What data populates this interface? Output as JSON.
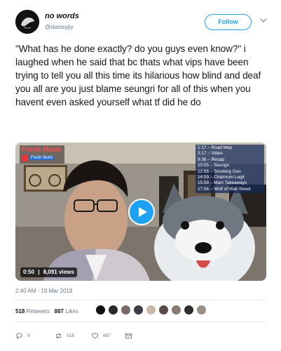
{
  "user": {
    "display_name": "no words",
    "handle": "@daissyjiy",
    "follow_label": "Follow"
  },
  "tweet": {
    "text": "\"What has he done exactly? do you guys even know?\" i laughed when he said that bc thats what vips have been trying to tell you all this time its hilarious how blind and deaf you all are you just blame seungri for all of this when you havent even asked yourself what tf did he do"
  },
  "video": {
    "brand_title": "Fresh Illumi",
    "brand_sub": "Fresh Illumi",
    "duration": "0:50",
    "views": "8,091 views",
    "chapters": [
      "1:17 – Road Map",
      "3:17 – Video",
      "9:36 – Recap",
      "10:55 – Seungri",
      "12:56 – Smoking Gun",
      "14:09 – Chatroom Legit",
      "15:58 – Main Takeaways",
      "17:56 – Wolf of Wall Street"
    ]
  },
  "meta": {
    "timestamp": "2:40 AM - 19 Mar 2019"
  },
  "stats": {
    "retweets_count": "518",
    "retweets_label": "Retweets",
    "likes_count": "887",
    "likes_label": "Likes"
  },
  "actions": {
    "reply_count": "9",
    "retweet_count": "518",
    "like_count": "887"
  },
  "colors": {
    "accent": "#1da1f2",
    "text": "#14171a",
    "muted": "#657786"
  },
  "icons": [
    "avatar-image",
    "chevron-down-icon",
    "play-icon",
    "reply-icon",
    "retweet-icon",
    "like-icon",
    "message-icon"
  ]
}
